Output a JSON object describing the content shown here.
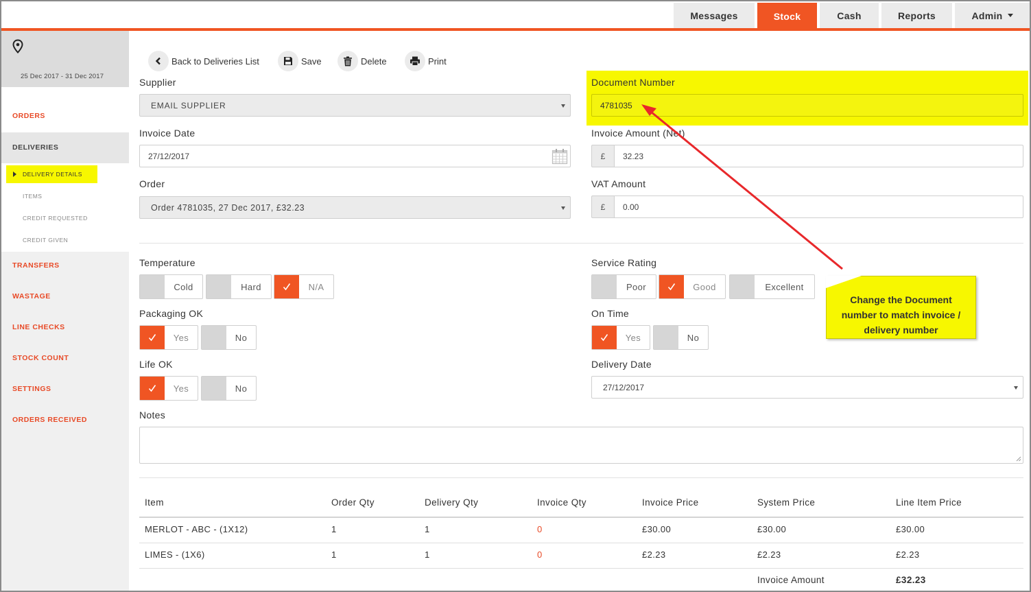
{
  "nav": {
    "messages": "Messages",
    "stock": "Stock",
    "cash": "Cash",
    "reports": "Reports",
    "admin": "Admin"
  },
  "sidebar": {
    "date_range": "25 Dec 2017 - 31 Dec 2017",
    "orders": "ORDERS",
    "deliveries": "DELIVERIES",
    "delivery_details": "DELIVERY DETAILS",
    "items": "ITEMS",
    "credit_requested": "CREDIT REQUESTED",
    "credit_given": "CREDIT GIVEN",
    "transfers": "TRANSFERS",
    "wastage": "WASTAGE",
    "line_checks": "LINE CHECKS",
    "stock_count": "STOCK COUNT",
    "settings": "SETTINGS",
    "orders_received": "ORDERS RECEIVED"
  },
  "toolbar": {
    "back": "Back to Deliveries List",
    "save": "Save",
    "delete": "Delete",
    "print": "Print"
  },
  "form": {
    "supplier_label": "Supplier",
    "supplier_value": "EMAIL SUPPLIER",
    "invoice_date_label": "Invoice Date",
    "invoice_date_value": "27/12/2017",
    "order_label": "Order",
    "order_value": "Order 4781035, 27 Dec 2017, £32.23",
    "document_number_label": "Document Number",
    "document_number_value": "4781035",
    "invoice_amount_label": "Invoice Amount (Net)",
    "invoice_amount_currency": "£",
    "invoice_amount_value": "32.23",
    "vat_amount_label": "VAT Amount",
    "vat_amount_currency": "£",
    "vat_amount_value": "0.00",
    "temperature_label": "Temperature",
    "temperature_cold": "Cold",
    "temperature_hard": "Hard",
    "temperature_na": "N/A",
    "packaging_label": "Packaging OK",
    "packaging_yes": "Yes",
    "packaging_no": "No",
    "life_label": "Life OK",
    "life_yes": "Yes",
    "life_no": "No",
    "service_label": "Service Rating",
    "service_poor": "Poor",
    "service_good": "Good",
    "service_excellent": "Excellent",
    "ontime_label": "On Time",
    "ontime_yes": "Yes",
    "ontime_no": "No",
    "delivery_date_label": "Delivery Date",
    "delivery_date_value": "27/12/2017",
    "notes_label": "Notes"
  },
  "table": {
    "headers": [
      "Item",
      "Order Qty",
      "Delivery Qty",
      "Invoice Qty",
      "Invoice Price",
      "System Price",
      "Line Item Price"
    ],
    "rows": [
      [
        "MERLOT - ABC - (1X12)",
        "1",
        "1",
        "0",
        "£30.00",
        "£30.00",
        "£30.00"
      ],
      [
        "LIMES - (1X6)",
        "1",
        "1",
        "0",
        "£2.23",
        "£2.23",
        "£2.23"
      ]
    ],
    "total_label": "Invoice Amount",
    "total_value": "£32.23"
  },
  "callout": {
    "line1": "Change the Document",
    "line2": "number to match invoice /",
    "line3": "delivery number"
  },
  "colors": {
    "accent": "#f05523",
    "highlight": "#f7f700",
    "arrow": "#e8282b"
  }
}
